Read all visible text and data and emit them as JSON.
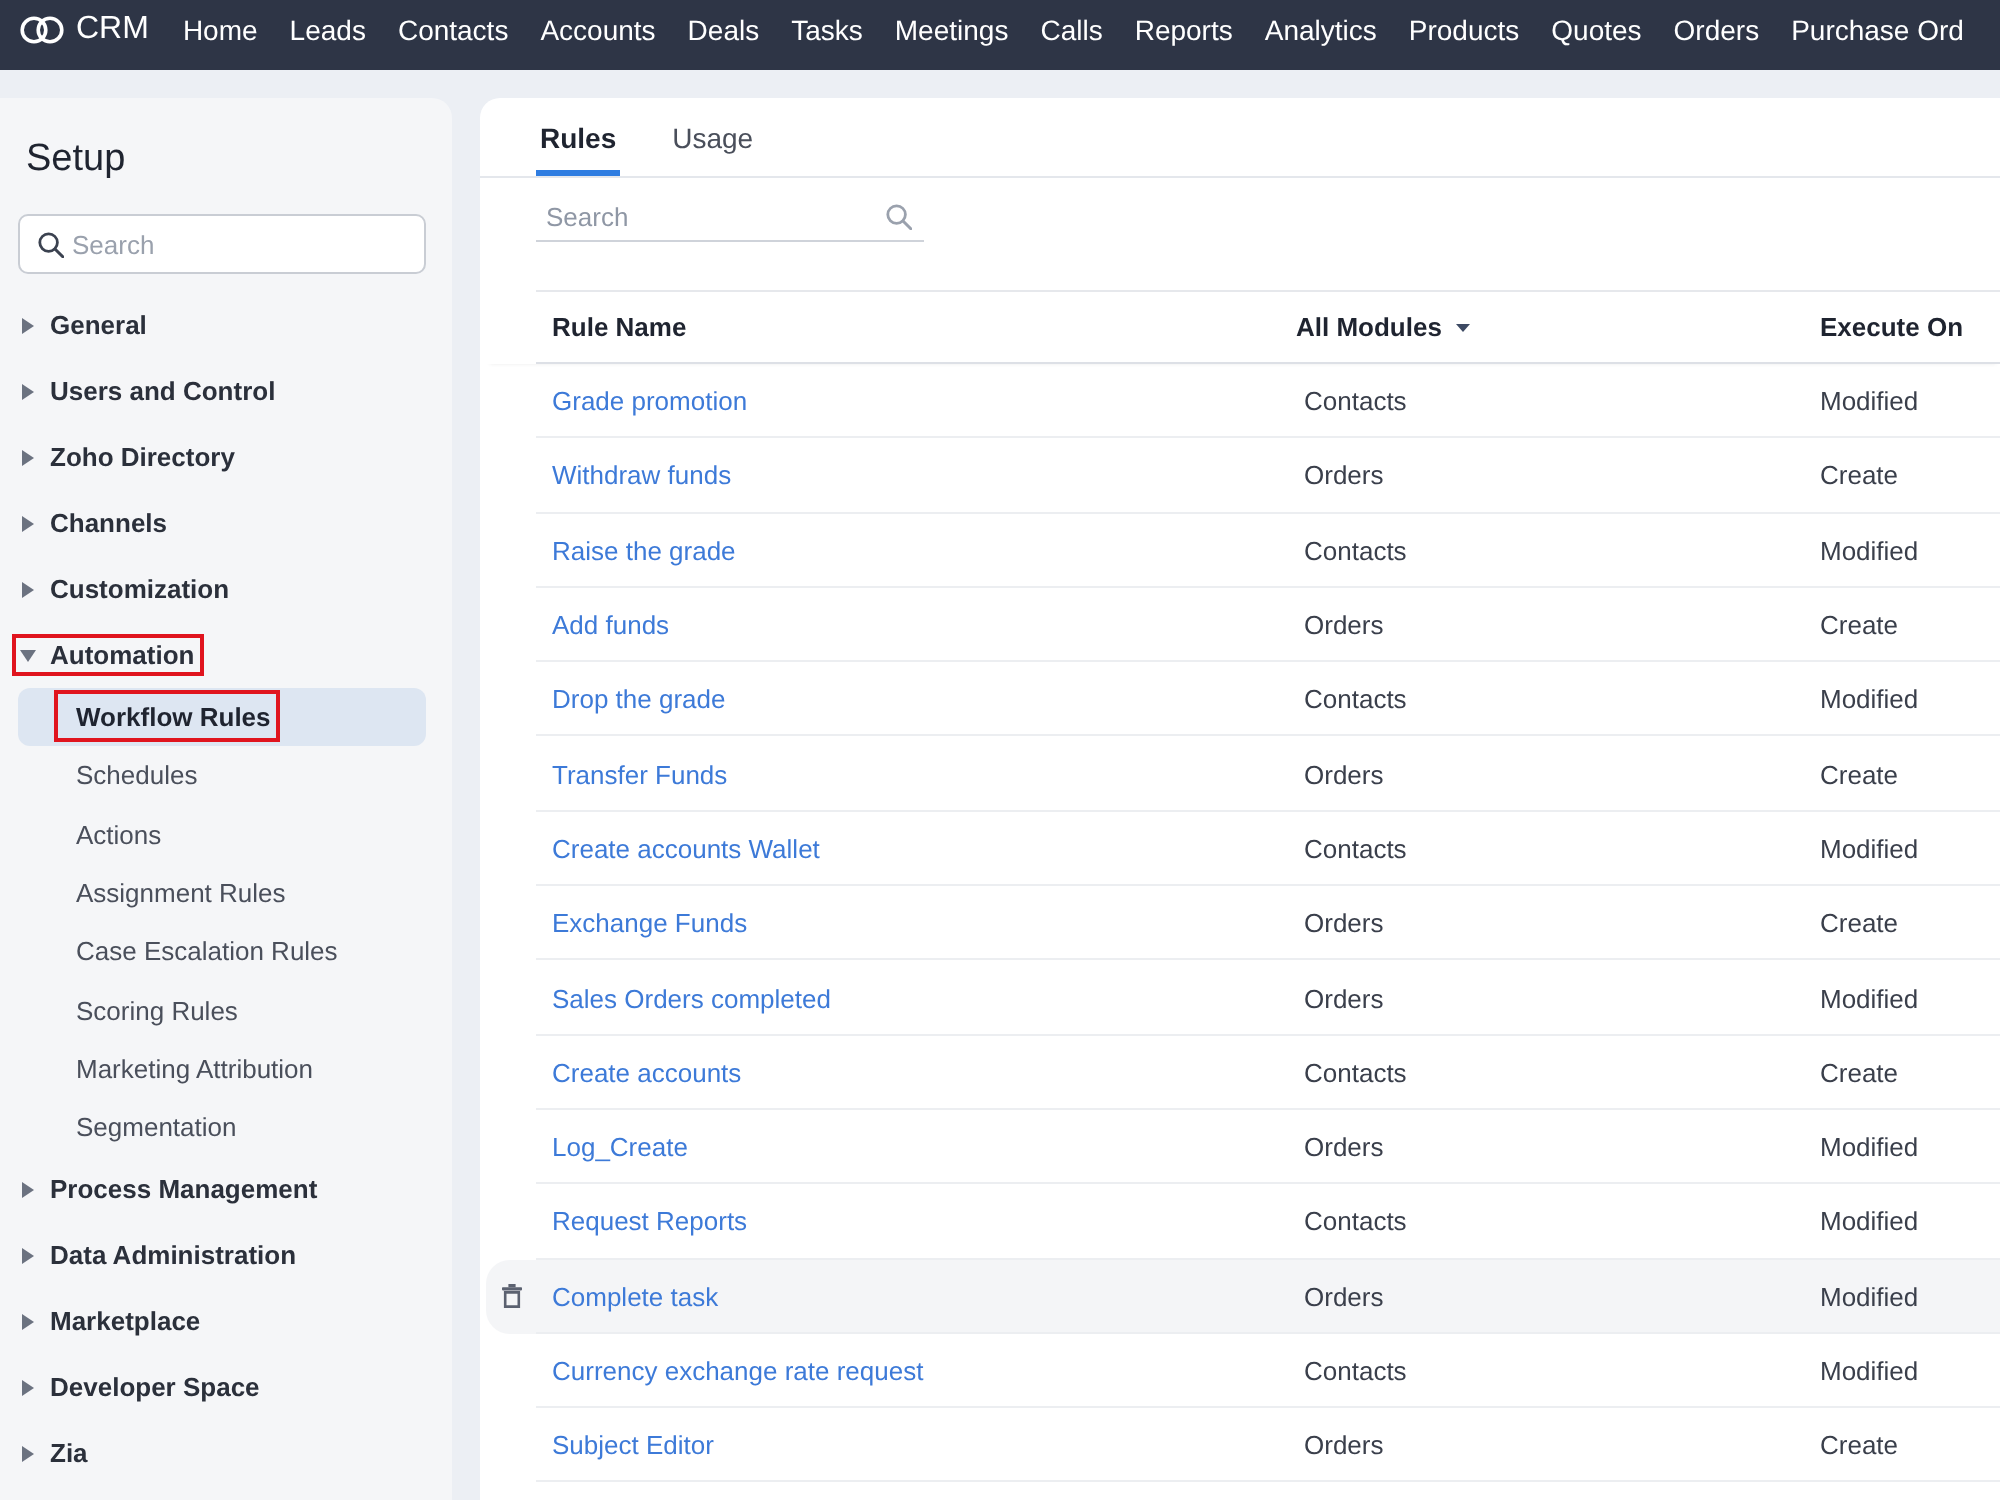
{
  "top_nav": {
    "app_name": "CRM",
    "items": [
      "Home",
      "Leads",
      "Contacts",
      "Accounts",
      "Deals",
      "Tasks",
      "Meetings",
      "Calls",
      "Reports",
      "Analytics",
      "Products",
      "Quotes",
      "Orders",
      "Purchase Ord"
    ]
  },
  "sidebar": {
    "title": "Setup",
    "search": {
      "placeholder": "Search"
    },
    "items": [
      {
        "label": "General",
        "expanded": false,
        "outlined": false
      },
      {
        "label": "Users and Control",
        "expanded": false,
        "outlined": false
      },
      {
        "label": "Zoho Directory",
        "expanded": false,
        "outlined": false
      },
      {
        "label": "Channels",
        "expanded": false,
        "outlined": false
      },
      {
        "label": "Customization",
        "expanded": false,
        "outlined": false
      },
      {
        "label": "Automation",
        "expanded": true,
        "outlined": true,
        "children": [
          {
            "label": "Workflow Rules",
            "selected": true,
            "outlined": true
          },
          {
            "label": "Schedules",
            "selected": false,
            "outlined": false
          },
          {
            "label": "Actions",
            "selected": false,
            "outlined": false
          },
          {
            "label": "Assignment Rules",
            "selected": false,
            "outlined": false
          },
          {
            "label": "Case Escalation Rules",
            "selected": false,
            "outlined": false
          },
          {
            "label": "Scoring Rules",
            "selected": false,
            "outlined": false
          },
          {
            "label": "Marketing Attribution",
            "selected": false,
            "outlined": false
          },
          {
            "label": "Segmentation",
            "selected": false,
            "outlined": false
          }
        ]
      },
      {
        "label": "Process Management",
        "expanded": false,
        "outlined": false
      },
      {
        "label": "Data Administration",
        "expanded": false,
        "outlined": false
      },
      {
        "label": "Marketplace",
        "expanded": false,
        "outlined": false
      },
      {
        "label": "Developer Space",
        "expanded": false,
        "outlined": false
      },
      {
        "label": "Zia",
        "expanded": false,
        "outlined": false
      }
    ]
  },
  "main": {
    "tabs": [
      {
        "label": "Rules",
        "selected": true
      },
      {
        "label": "Usage",
        "selected": false
      }
    ],
    "search": {
      "placeholder": "Search"
    },
    "table": {
      "columns": [
        {
          "label": "Rule Name",
          "kind": "text"
        },
        {
          "label": "All Modules",
          "kind": "dropdown"
        },
        {
          "label": "Execute On",
          "kind": "text"
        }
      ],
      "rows": [
        {
          "rule_name": "Grade promotion",
          "module": "Contacts",
          "execute_on": "Modified",
          "hovered": false
        },
        {
          "rule_name": "Withdraw funds",
          "module": "Orders",
          "execute_on": "Create",
          "hovered": false
        },
        {
          "rule_name": "Raise the grade",
          "module": "Contacts",
          "execute_on": "Modified",
          "hovered": false
        },
        {
          "rule_name": "Add funds",
          "module": "Orders",
          "execute_on": "Create",
          "hovered": false
        },
        {
          "rule_name": "Drop the grade",
          "module": "Contacts",
          "execute_on": "Modified",
          "hovered": false
        },
        {
          "rule_name": "Transfer Funds",
          "module": "Orders",
          "execute_on": "Create",
          "hovered": false
        },
        {
          "rule_name": "Create accounts Wallet",
          "module": "Contacts",
          "execute_on": "Modified",
          "hovered": false
        },
        {
          "rule_name": "Exchange Funds",
          "module": "Orders",
          "execute_on": "Create",
          "hovered": false
        },
        {
          "rule_name": "Sales Orders completed",
          "module": "Orders",
          "execute_on": "Modified",
          "hovered": false
        },
        {
          "rule_name": "Create accounts",
          "module": "Contacts",
          "execute_on": "Create",
          "hovered": false
        },
        {
          "rule_name": "Log_Create",
          "module": "Orders",
          "execute_on": "Modified",
          "hovered": false
        },
        {
          "rule_name": "Request Reports",
          "module": "Contacts",
          "execute_on": "Modified",
          "hovered": false
        },
        {
          "rule_name": "Complete task",
          "module": "Orders",
          "execute_on": "Modified",
          "hovered": true
        },
        {
          "rule_name": "Currency exchange rate request",
          "module": "Contacts",
          "execute_on": "Modified",
          "hovered": false
        },
        {
          "rule_name": "Subject Editor",
          "module": "Orders",
          "execute_on": "Create",
          "hovered": false
        }
      ]
    }
  }
}
